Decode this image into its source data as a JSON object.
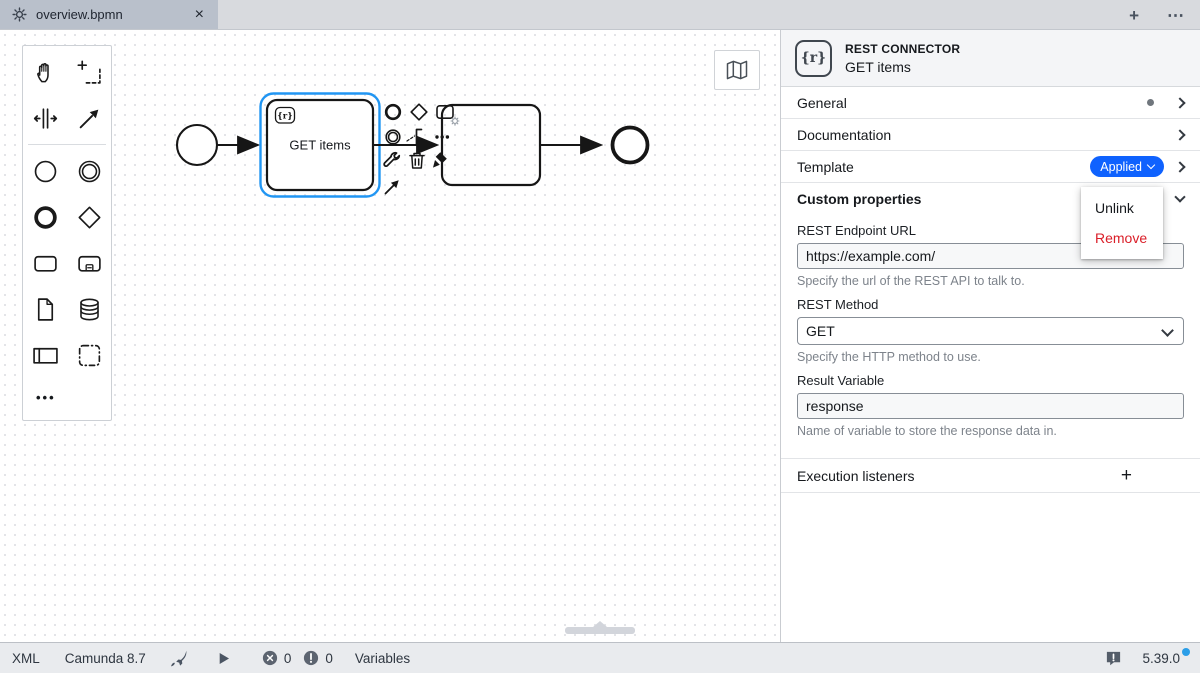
{
  "tab_bar": {
    "tabs": [
      {
        "title": "overview.bpmn"
      }
    ],
    "close_glyph": "×",
    "new_tab_glyph": "+",
    "more_glyph": "⋯"
  },
  "palette": {
    "tools": [
      "hand-tool",
      "lasso-tool",
      "space-tool",
      "global-connect-tool"
    ],
    "elements": [
      "create-start-event",
      "create-intermediate-event",
      "create-end-event",
      "create-gateway",
      "create-task",
      "create-expanded-subprocess",
      "create-data-object",
      "create-data-store",
      "create-participant",
      "create-group"
    ],
    "more_glyph": "•••"
  },
  "canvas": {
    "selected_task": {
      "label": "GET items",
      "badge": "{r}"
    },
    "context_pad": [
      "append-end-event",
      "append-gateway",
      "append-task",
      "template-gear",
      "append-intermediate-event",
      "append-text-annotation",
      "more-actions",
      "change-type-wrench",
      "delete-trash",
      "set-color-brush",
      "connect-arrow"
    ],
    "minimap_toggle": "map-icon"
  },
  "properties_panel": {
    "header": {
      "icon": "{r}",
      "type": "REST CONNECTOR",
      "name": "GET items"
    },
    "groups": [
      {
        "label": "General",
        "modified": true
      },
      {
        "label": "Documentation"
      },
      {
        "label": "Template",
        "badge": "Applied"
      }
    ],
    "template_menu": {
      "items": [
        {
          "label": "Unlink"
        },
        {
          "label": "Remove"
        }
      ]
    },
    "custom_properties": {
      "label": "Custom properties",
      "fields": [
        {
          "label": "REST Endpoint URL",
          "value": "https://example.com/",
          "help": "Specify the url of the REST API to talk to.",
          "control": "input"
        },
        {
          "label": "REST Method",
          "value": "GET",
          "help": "Specify the HTTP method to use.",
          "control": "select"
        },
        {
          "label": "Result Variable",
          "value": "response",
          "help": "Name of variable to store the response data in.",
          "control": "input"
        }
      ]
    },
    "execution_listeners": {
      "label": "Execution listeners",
      "add_glyph": "+"
    }
  },
  "status_bar": {
    "items": [
      "XML",
      "Camunda 8.7"
    ],
    "errors": "0",
    "warnings": "0",
    "variables_label": "Variables",
    "version": "5.39.0",
    "update_available": true
  },
  "colors": {
    "accent_blue": "#0f62fe",
    "selection_blue": "#2196f3",
    "danger_red": "#da1e28",
    "update_dot_blue": "#2b9ee8"
  }
}
